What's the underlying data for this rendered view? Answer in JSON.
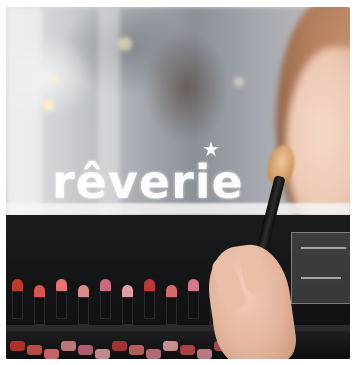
{
  "image": {
    "brand_text": "rêverie",
    "icon": "star-icon",
    "colors": {
      "lipstick_reds": [
        "#c0392b",
        "#d9534f",
        "#e57373",
        "#d98a8a",
        "#c96b7a",
        "#e0a0a0",
        "#b83a3a",
        "#d46a6a",
        "#cf7a86",
        "#e6a3a3",
        "#c44a4a",
        "#d88b9b",
        "#b85050"
      ]
    }
  }
}
